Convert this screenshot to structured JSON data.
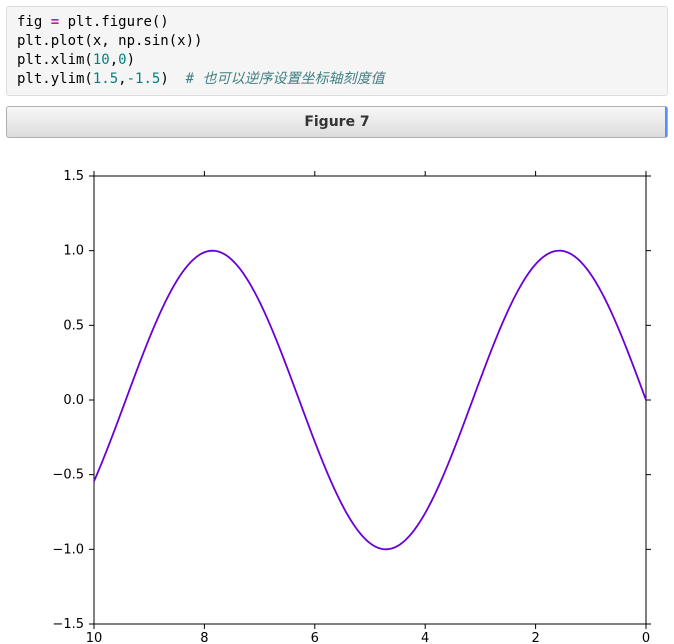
{
  "code": {
    "l1a": "fig ",
    "l1op": "=",
    "l1b": " plt.figure()",
    "l2": "plt.plot(x, np.sin(x))",
    "l3a": "plt.xlim(",
    "l3n1": "10",
    "l3c": ",",
    "l3n2": "0",
    "l3b": ")",
    "l4a": "plt.ylim(",
    "l4n1": "1.5",
    "l4c": ",",
    "l4n2": "-1.5",
    "l4b": ")  ",
    "l4comment": "# 也可以逆序设置坐标轴刻度值"
  },
  "figure_title": "Figure 7",
  "chart_data": {
    "type": "line",
    "series": [
      {
        "name": "sin(x)",
        "expr": "y = sin(x)",
        "x_range": [
          0,
          10
        ],
        "samples": 200
      }
    ],
    "xlim": [
      10,
      0
    ],
    "ylim": [
      1.5,
      -1.5
    ],
    "xticks": [
      10,
      8,
      6,
      4,
      2,
      0
    ],
    "yticks": [
      -1.5,
      -1.0,
      -0.5,
      0.0,
      0.5,
      1.0,
      1.5
    ],
    "ytick_labels": [
      "−1.5",
      "−1.0",
      "−0.5",
      "0.0",
      "0.5",
      "1.0",
      "1.5"
    ],
    "line_color": "#6a00d8",
    "title": "",
    "xlabel": "",
    "ylabel": ""
  }
}
